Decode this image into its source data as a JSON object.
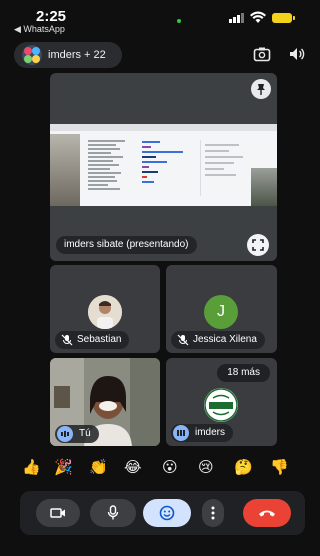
{
  "status_bar": {
    "time": "2:25",
    "back_app": "◀ WhatsApp"
  },
  "meeting": {
    "group_name": "imders + 22"
  },
  "presenter_tile": {
    "label": "imders sibate (presentando)"
  },
  "participants": [
    {
      "name": "Sebastian",
      "muted": true
    },
    {
      "name": "Jessica Xilena",
      "initial": "J",
      "muted": true
    }
  ],
  "self_tile": {
    "label": "Tú"
  },
  "overflow_tile": {
    "count_label": "18 más",
    "name": "imders"
  },
  "reactions": [
    "👍",
    "🎉",
    "👏",
    "😂",
    "😮",
    "😢",
    "🤔",
    "👎"
  ],
  "controls": {
    "camera": "camera-icon",
    "mic": "mic-icon",
    "react": "emoji-icon",
    "more": "more-vert-icon",
    "end": "end-call-icon"
  },
  "colors": {
    "end_call": "#ea4335",
    "react_active": "#d3e3fd",
    "avatar_j": "#5a9e3a"
  }
}
